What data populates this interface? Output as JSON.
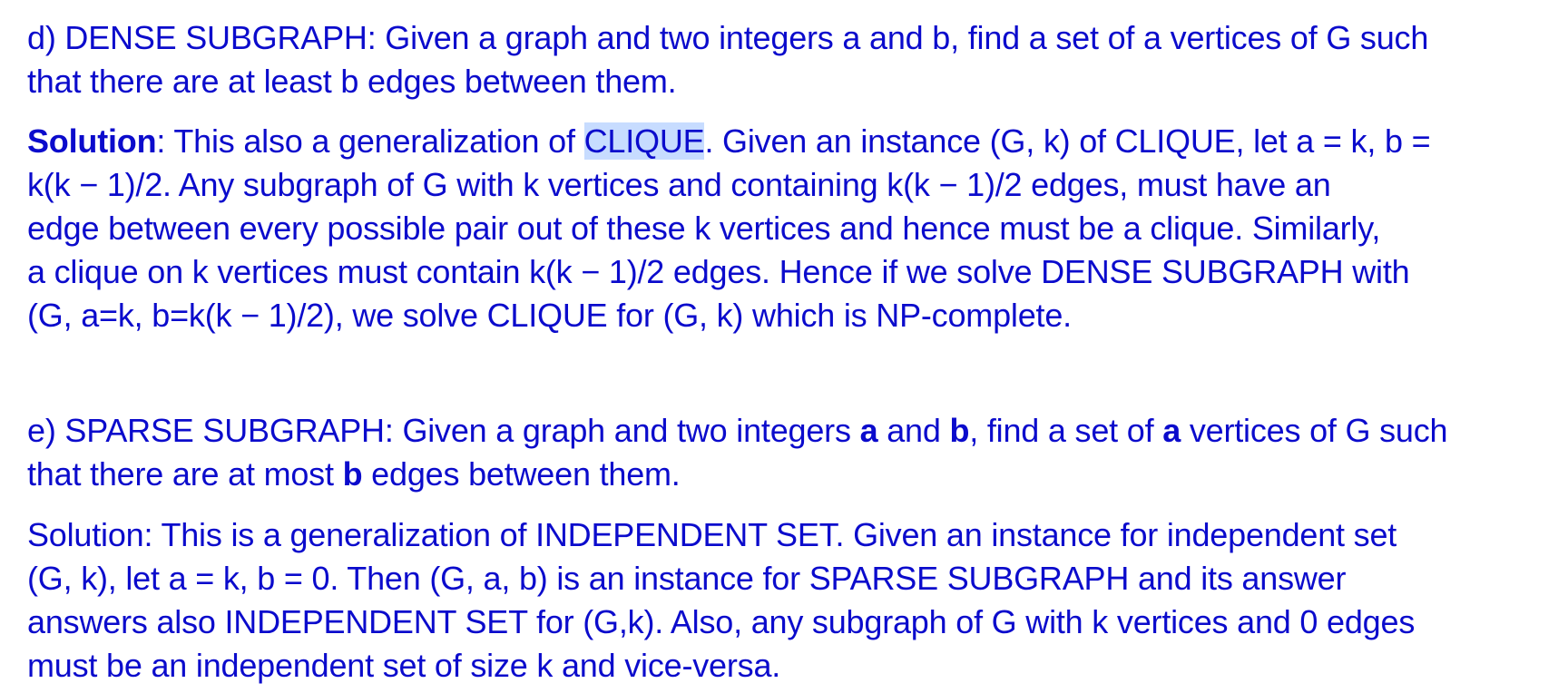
{
  "part_d": {
    "question": {
      "line1": "d) DENSE SUBGRAPH: Given a graph and two integers a and b, find a set of a vertices of G such",
      "line2": "that there are at least b edges between them."
    },
    "solution": {
      "label": "Solution",
      "line1_before": ": This also a generalization of ",
      "line1_highlight": "CLIQUE",
      "line1_after": ". Given an instance (G, k) of CLIQUE, let a = k, b =",
      "line2": "k(k − 1)/2. Any subgraph of G with k vertices and containing k(k − 1)/2 edges, must have an",
      "line3": "edge between every possible pair out of these k vertices and hence must be a clique. Similarly,",
      "line4": "a clique on k vertices must contain k(k − 1)/2 edges. Hence if we solve DENSE SUBGRAPH with",
      "line5": "(G, a=k, b=k(k − 1)/2), we solve CLIQUE for (G, k) which is NP-complete."
    }
  },
  "part_e": {
    "question": {
      "line1_a": "e) SPARSE SUBGRAPH: Given a graph and two integers ",
      "line1_b_bold": "a",
      "line1_c": " and ",
      "line1_d_bold": "b",
      "line1_e": ", find a set of ",
      "line1_f_bold": "a",
      "line1_g": " vertices of G such",
      "line2_a": "that there are at most ",
      "line2_b_bold": "b",
      "line2_c": " edges between them."
    },
    "solution": {
      "line1": "Solution: This is a generalization of INDEPENDENT SET. Given an instance for independent set",
      "line2": "(G, k), let a = k, b = 0. Then (G, a, b) is an instance for SPARSE SUBGRAPH and its answer",
      "line3": "answers also INDEPENDENT SET for (G,k). Also, any subgraph of G with k vertices and 0 edges",
      "line4": "must be an independent set of size k and vice-versa."
    }
  },
  "colors": {
    "text": "#0b0bcc",
    "highlight": "#c7dcff",
    "background": "#ffffff"
  }
}
